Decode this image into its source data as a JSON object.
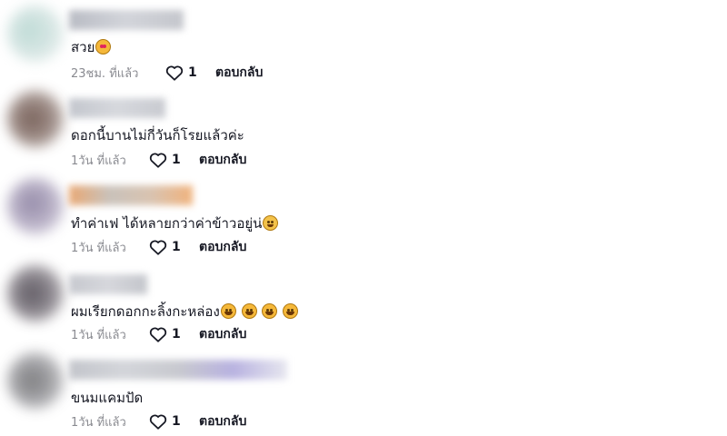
{
  "comments": [
    {
      "text": "สวย",
      "time": "23ชม. ที่แล้ว",
      "likes": "1",
      "reply": "ตอบกลับ"
    },
    {
      "text": "ดอกนี้บานไม่กี่วันก็โรยแล้วค่ะ",
      "time": "1วัน ที่แล้ว",
      "likes": "1",
      "reply": "ตอบกลับ"
    },
    {
      "text": "ทำค่าเฟ ได้หลายกว่าค่าข้าวอยู่น่",
      "time": "1วัน ที่แล้ว",
      "likes": "1",
      "reply": "ตอบกลับ"
    },
    {
      "text": "ผมเรียกดอกกะลิ้งกะหล่อง",
      "time": "1วัน ที่แล้ว",
      "likes": "1",
      "reply": "ตอบกลับ"
    },
    {
      "text": "ขนมแคมปัด",
      "time": "1วัน ที่แล้ว",
      "likes": "1",
      "reply": "ตอบกลับ"
    }
  ],
  "icons": {
    "like": "heart-outline-icon"
  },
  "colors": {
    "text": "#161823",
    "muted": "#8a8b91"
  }
}
